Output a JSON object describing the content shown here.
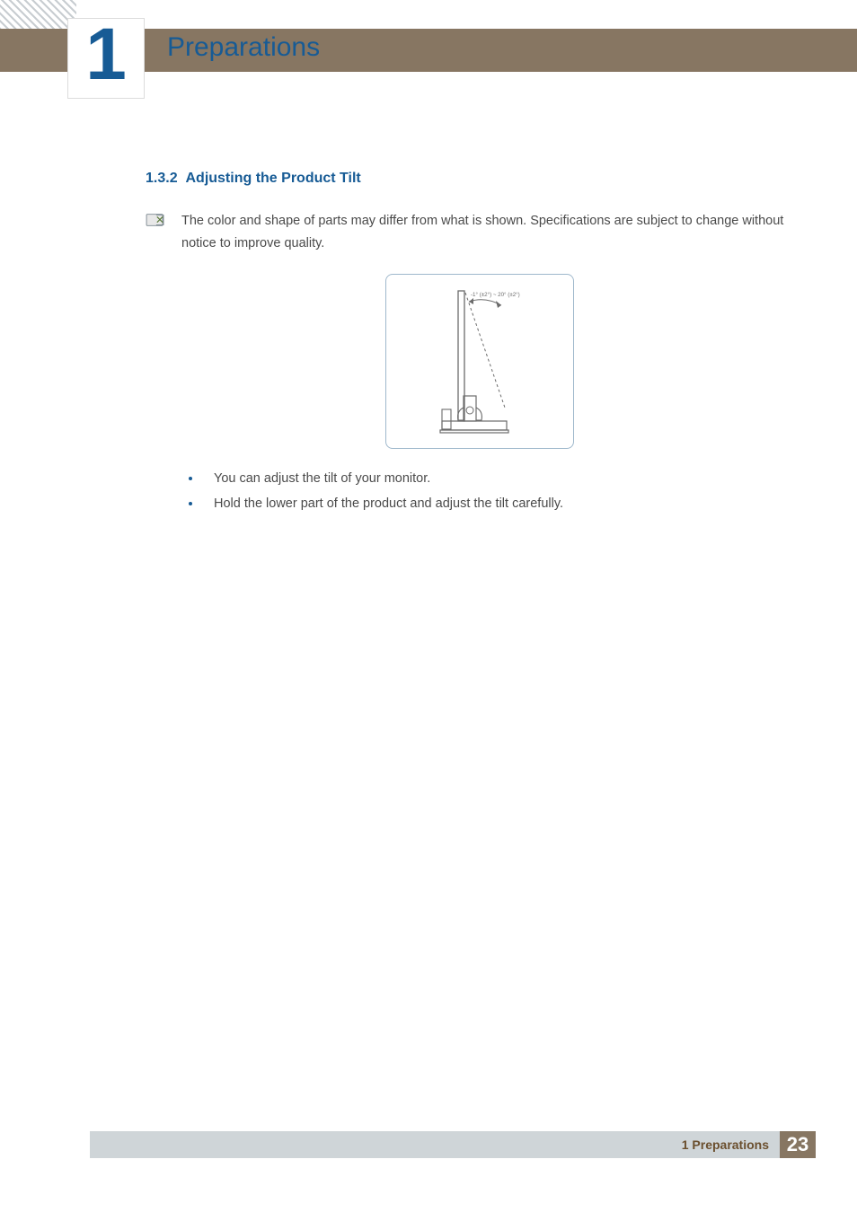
{
  "header": {
    "chapter_number": "1",
    "chapter_title": "Preparations"
  },
  "section": {
    "number": "1.3.2",
    "title": "Adjusting the Product Tilt"
  },
  "note": {
    "text": "The color and shape of parts may differ from what is shown. Specifications are subject to change without notice to improve quality."
  },
  "figure": {
    "tilt_label": "-1° (±2°) ~ 20° (±2°)"
  },
  "bullets": [
    "You can adjust the tilt of your monitor.",
    "Hold the lower part of the product and adjust the tilt carefully."
  ],
  "footer": {
    "text": "1 Preparations",
    "page": "23"
  }
}
